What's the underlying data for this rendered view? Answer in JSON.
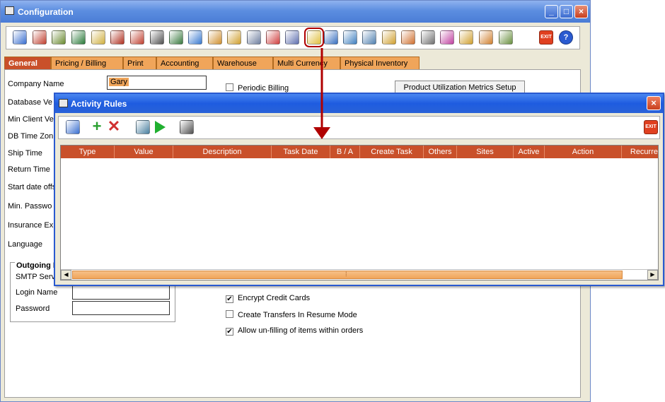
{
  "config": {
    "title": "Configuration",
    "window_buttons": {
      "minimize": "_",
      "maximize": "□",
      "close": "×"
    },
    "toolbar": {
      "icons": [
        {
          "name": "save-icon",
          "color": "#3a6fd0"
        },
        {
          "name": "report-icon",
          "color": "#c04030"
        },
        {
          "name": "dollar-icon",
          "color": "#6a8a30"
        },
        {
          "name": "document-icon",
          "color": "#2a7a3a"
        },
        {
          "name": "edit-icon",
          "color": "#d0b040"
        },
        {
          "name": "invoice-icon",
          "color": "#b03020"
        },
        {
          "name": "pricing-icon",
          "color": "#c04030"
        },
        {
          "name": "grid-icon",
          "color": "#505050"
        },
        {
          "name": "print-icon",
          "color": "#3a7a40"
        },
        {
          "name": "puzzle-icon",
          "color": "#3a7ad0"
        },
        {
          "name": "calendar-icon",
          "color": "#d09030"
        },
        {
          "name": "ruler-icon",
          "color": "#d0a030"
        },
        {
          "name": "gears-icon",
          "color": "#7080a0"
        },
        {
          "name": "color-circles-icon",
          "color": "#d04040"
        },
        {
          "name": "tools-icon",
          "color": "#6070b0"
        },
        {
          "name": "activity-rules-icon",
          "color": "#e0c040"
        },
        {
          "name": "credit-card-icon",
          "color": "#3a70c0"
        },
        {
          "name": "copy-document-icon",
          "color": "#4080c0"
        },
        {
          "name": "search-document-icon",
          "color": "#5080b0"
        },
        {
          "name": "gift-icon",
          "color": "#d0a030"
        },
        {
          "name": "settings-icon",
          "color": "#d07030"
        },
        {
          "name": "sync-icon",
          "color": "#707070"
        },
        {
          "name": "notes-icon",
          "color": "#c040a0"
        },
        {
          "name": "user-settings-icon",
          "color": "#d0a030"
        },
        {
          "name": "key-icon",
          "color": "#d08030"
        },
        {
          "name": "server-icon",
          "color": "#6a9040"
        },
        {
          "name": "exit-icon",
          "color": "#e04020"
        },
        {
          "name": "help-icon",
          "color": "#2a5ad0"
        }
      ],
      "exit_label": "EXIT",
      "help_label": "?"
    },
    "tabs": [
      {
        "label": "General",
        "active": true
      },
      {
        "label": "Pricing / Billing"
      },
      {
        "label": "Print"
      },
      {
        "label": "Accounting"
      },
      {
        "label": "Warehouse"
      },
      {
        "label": "Multi Currency"
      },
      {
        "label": "Physical Inventory"
      }
    ],
    "form": {
      "company_name_label": "Company Name",
      "company_name_value": "Gary",
      "database_version_label": "Database Ve",
      "min_client_version_label": "Min Client Ve",
      "db_time_zone_label": "DB Time Zon",
      "ship_time_label": "Ship Time",
      "return_time_label": "Return Time",
      "start_date_offset_label": "Start date offs",
      "min_password_label": "Min. Passwo",
      "insurance_label": "Insurance Ex",
      "language_label": "Language",
      "periodic_billing_label": "Periodic Billing",
      "product_metrics_button": "Product Utilization Metrics Setup",
      "outgoing_legend": "Outgoing M",
      "smtp_server_label": "SMTP Serv",
      "login_name_label": "Login Name",
      "password_label": "Password",
      "encrypt_cards_label": "Encrypt Credit Cards",
      "transfers_resume_label": "Create Transfers In Resume Mode",
      "unfill_items_label": "Allow un-filling of items within orders",
      "checks": {
        "encrypt": "✔",
        "unfill": "✔"
      }
    }
  },
  "activity": {
    "title": "Activity Rules",
    "close_label": "×",
    "toolbar": {
      "icons": [
        {
          "name": "save-icon",
          "color": "#3a6fd0"
        },
        {
          "name": "add-icon",
          "color": "#2aa030"
        },
        {
          "name": "delete-icon",
          "color": "#d03030"
        },
        {
          "name": "refresh-icon",
          "color": "#4a80a0"
        },
        {
          "name": "run-icon",
          "color": "#20b030"
        },
        {
          "name": "calculator-icon",
          "color": "#505050"
        }
      ],
      "exit_label": "EXIT"
    },
    "columns": [
      "Type",
      "Value",
      "Description",
      "Task Date",
      "B / A",
      "Create Task",
      "Others",
      "Sites",
      "Active",
      "Action",
      "Recurren"
    ],
    "scroll_left": "◀",
    "scroll_right": "▶",
    "scroll_grip": "⁞"
  }
}
